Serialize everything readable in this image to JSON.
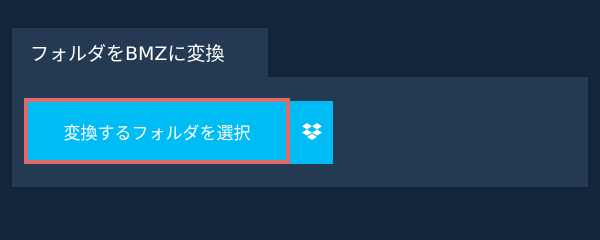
{
  "tab": {
    "label": "フォルダをBMZに変換"
  },
  "actions": {
    "select_folder_label": "変換するフォルダを選択",
    "dropbox_icon": "dropbox-icon"
  },
  "colors": {
    "background": "#13253b",
    "panel": "#233a52",
    "button": "#00bcf5",
    "highlight_border": "#e06a6a",
    "text": "#ffffff"
  }
}
